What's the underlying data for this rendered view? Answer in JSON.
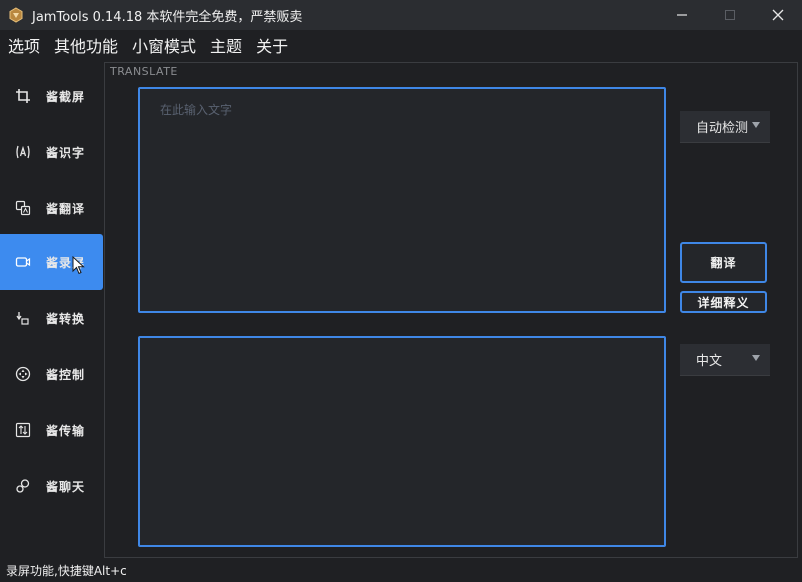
{
  "titlebar": {
    "title": "JamTools 0.14.18 本软件完全免费，严禁贩卖",
    "icon": "jamtools-logo-icon"
  },
  "menu": [
    {
      "label": "选项"
    },
    {
      "label": "其他功能"
    },
    {
      "label": "小窗模式"
    },
    {
      "label": "主题"
    },
    {
      "label": "关于"
    }
  ],
  "sidebar": {
    "items": [
      {
        "label": "酱截屏",
        "icon": "crop-icon"
      },
      {
        "label": "酱识字",
        "icon": "ocr-icon"
      },
      {
        "label": "酱翻译",
        "icon": "translate-icon"
      },
      {
        "label": "酱录屏",
        "icon": "record-icon",
        "active": true
      },
      {
        "label": "酱转换",
        "icon": "convert-icon"
      },
      {
        "label": "酱控制",
        "icon": "control-icon"
      },
      {
        "label": "酱传输",
        "icon": "transfer-icon"
      },
      {
        "label": "酱聊天",
        "icon": "chat-icon"
      }
    ],
    "active_color": "#3d8bef"
  },
  "translate": {
    "section_title": "TRANSLATE",
    "input_placeholder": "在此输入文字",
    "source_language": "自动检测",
    "target_language": "中文",
    "translate_button": "翻译",
    "detail_button": "详细释义"
  },
  "status": {
    "text": "录屏功能,快捷键Alt+c"
  },
  "colors": {
    "accent": "#3f87e6",
    "background": "#1f2023"
  }
}
